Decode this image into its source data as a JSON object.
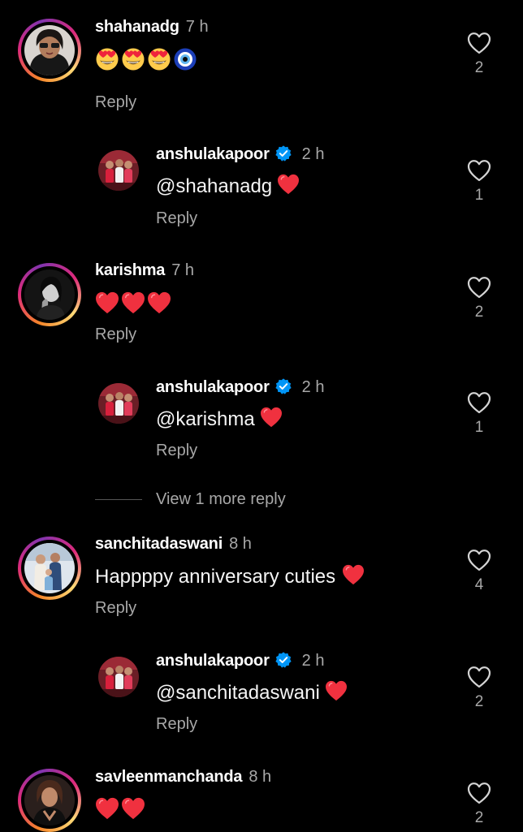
{
  "comments": [
    {
      "username": "shahanadg",
      "time": "7 h",
      "text": "",
      "emojis": [
        "heart-eyes-emoji",
        "heart-eyes-emoji",
        "heart-eyes-emoji",
        "nazar-amulet-emoji"
      ],
      "reply_label": "Reply",
      "likes": "2",
      "reply": {
        "username": "anshulakapoor",
        "time": "2 h",
        "text": "@shahanadg",
        "trailing_emoji": "red-heart-emoji",
        "reply_label": "Reply",
        "likes": "1"
      }
    },
    {
      "username": "karishma",
      "time": "7 h",
      "text": "",
      "emojis": [
        "red-heart-emoji",
        "red-heart-emoji",
        "red-heart-emoji"
      ],
      "reply_label": "Reply",
      "likes": "2",
      "reply": {
        "username": "anshulakapoor",
        "time": "2 h",
        "text": "@karishma",
        "trailing_emoji": "red-heart-emoji",
        "reply_label": "Reply",
        "likes": "1"
      },
      "view_more": "View 1 more reply"
    },
    {
      "username": "sanchitadaswani",
      "time": "8 h",
      "text": "Happppy anniversary cuties",
      "emojis": [
        "red-heart-emoji"
      ],
      "reply_label": "Reply",
      "likes": "4",
      "reply": {
        "username": "anshulakapoor",
        "time": "2 h",
        "text": "@sanchitadaswani",
        "trailing_emoji": "red-heart-emoji",
        "reply_label": "Reply",
        "likes": "2"
      }
    },
    {
      "username": "savleenmanchanda",
      "time": "8 h",
      "text": "",
      "emojis": [
        "red-heart-emoji",
        "red-heart-emoji"
      ],
      "likes": "2"
    }
  ],
  "colors": {
    "background": "#000000",
    "text_primary": "#ffffff",
    "text_secondary": "#a8a8a8",
    "verified_blue": "#0095f6",
    "heart_red": "#f0313f"
  }
}
